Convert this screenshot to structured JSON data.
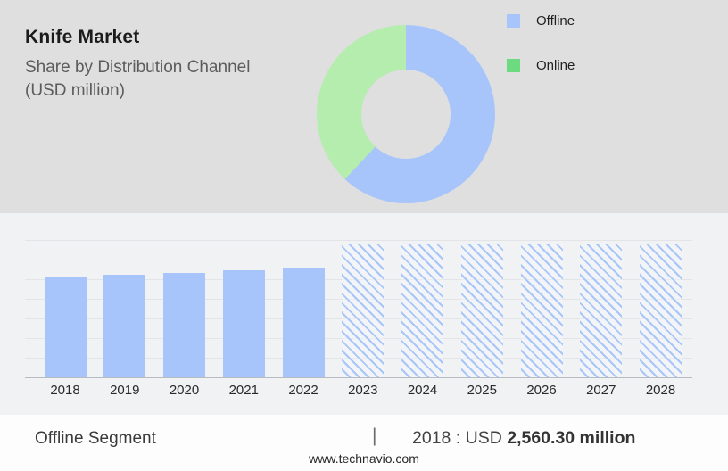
{
  "header": {
    "title": "Knife Market",
    "subtitle_line1": "Share by Distribution Channel",
    "subtitle_line2": "(USD million)"
  },
  "legend": {
    "items": [
      {
        "label": "Offline",
        "color": "#a8c5fb"
      },
      {
        "label": "Online",
        "color": "#6cdb80"
      }
    ]
  },
  "footer": {
    "segment_label": "Offline Segment",
    "divider": "|",
    "stat_prefix": "2018 : USD",
    "stat_value": "2,560.30 million",
    "website": "www.technavio.com"
  },
  "colors": {
    "top_background": "#dfdfdf",
    "chart_background": "#f1f2f4",
    "bottom_background": "#fdfdfd",
    "bar_blue": "#a8c5fb",
    "hatch_blue": "#a9c6f8",
    "donut_blue": "#a8c5fb",
    "donut_green": "#b4edae",
    "legend_green": "#6cdb80"
  },
  "chart_data": [
    {
      "type": "pie",
      "donut": true,
      "title": "Share by Distribution Channel (USD million)",
      "labels": [
        "Offline",
        "Online"
      ],
      "values": [
        62,
        38
      ],
      "value_unit": "percent (estimated from arc angles)",
      "colors": [
        "#a8c5fb",
        "#b4edae"
      ],
      "start_angle_deg": 0,
      "legend_position": "right"
    },
    {
      "type": "bar",
      "title": "Knife Market size by year (USD million)",
      "categories": [
        "2018",
        "2019",
        "2020",
        "2021",
        "2022",
        "2023",
        "2024",
        "2025",
        "2026",
        "2027",
        "2028"
      ],
      "values": [
        2560.3,
        2610,
        2660,
        2730,
        2800,
        3390,
        3390,
        3390,
        3390,
        3390,
        3390
      ],
      "historical_count": 5,
      "forecast_style": "hatched placeholder bars (2023-2028), heights uniform, values estimated from gridlines",
      "known_value_label": "2018 : USD 2,560.30 million",
      "xlabel": "",
      "ylabel": "",
      "ylim": [
        0,
        3500
      ],
      "gridline_step": 500,
      "grid": true,
      "legend_position": "none"
    }
  ]
}
